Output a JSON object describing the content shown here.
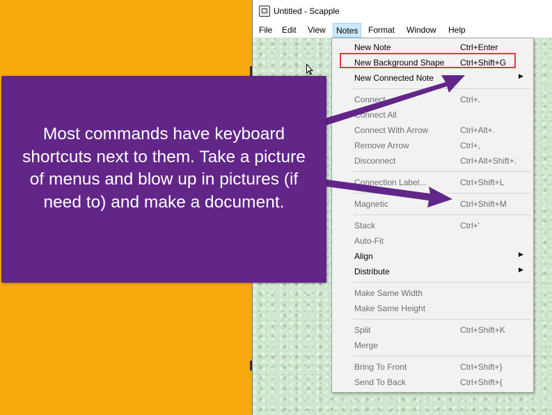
{
  "window": {
    "title": "Untitled - Scapple"
  },
  "menubar": {
    "items": [
      "File",
      "Edit",
      "View",
      "Notes",
      "Format",
      "Window",
      "Help"
    ],
    "active": "Notes"
  },
  "menu": {
    "items": [
      {
        "label": "New Note",
        "shortcut": "Ctrl+Enter",
        "enabled": true
      },
      {
        "label": "New Background Shape",
        "shortcut": "Ctrl+Shift+G",
        "enabled": true,
        "highlighted": true
      },
      {
        "label": "New Connected Note",
        "shortcut": "",
        "enabled": true,
        "submenu": true
      },
      {
        "label": "Connect",
        "shortcut": "Ctrl+.",
        "enabled": false
      },
      {
        "label": "Connect All",
        "shortcut": "",
        "enabled": false
      },
      {
        "label": "Connect With Arrow",
        "shortcut": "Ctrl+Alt+.",
        "enabled": false
      },
      {
        "label": "Remove Arrow",
        "shortcut": "Ctrl+,",
        "enabled": false
      },
      {
        "label": "Disconnect",
        "shortcut": "Ctrl+Alt+Shift+.",
        "enabled": false
      },
      {
        "label": "Connection Label...",
        "shortcut": "Ctrl+Shift+L",
        "enabled": false
      },
      {
        "label": "Magnetic",
        "shortcut": "Ctrl+Shift+M",
        "enabled": false
      },
      {
        "label": "Stack",
        "shortcut": "Ctrl+'",
        "enabled": false
      },
      {
        "label": "Auto-Fit",
        "shortcut": "",
        "enabled": false
      },
      {
        "label": "Align",
        "shortcut": "",
        "enabled": true,
        "submenu": true
      },
      {
        "label": "Distribute",
        "shortcut": "",
        "enabled": true,
        "submenu": true
      },
      {
        "label": "Make Same Width",
        "shortcut": "",
        "enabled": false
      },
      {
        "label": "Make Same Height",
        "shortcut": "",
        "enabled": false
      },
      {
        "label": "Split",
        "shortcut": "Ctrl+Shift+K",
        "enabled": false
      },
      {
        "label": "Merge",
        "shortcut": "",
        "enabled": false
      },
      {
        "label": "Bring To Front",
        "shortcut": "Ctrl+Shift+}",
        "enabled": false
      },
      {
        "label": "Send To Back",
        "shortcut": "Ctrl+Shift+{",
        "enabled": false
      }
    ]
  },
  "callout": {
    "text": "Most commands have keyboard shortcuts next to them. Take a picture of menus and blow up in pictures (if need to) and make a document."
  },
  "colors": {
    "orange_background": "#f7a80c",
    "callout_purple": "#622689",
    "highlight_red": "#e03a3a",
    "canvas_green": "#cde6cd"
  }
}
